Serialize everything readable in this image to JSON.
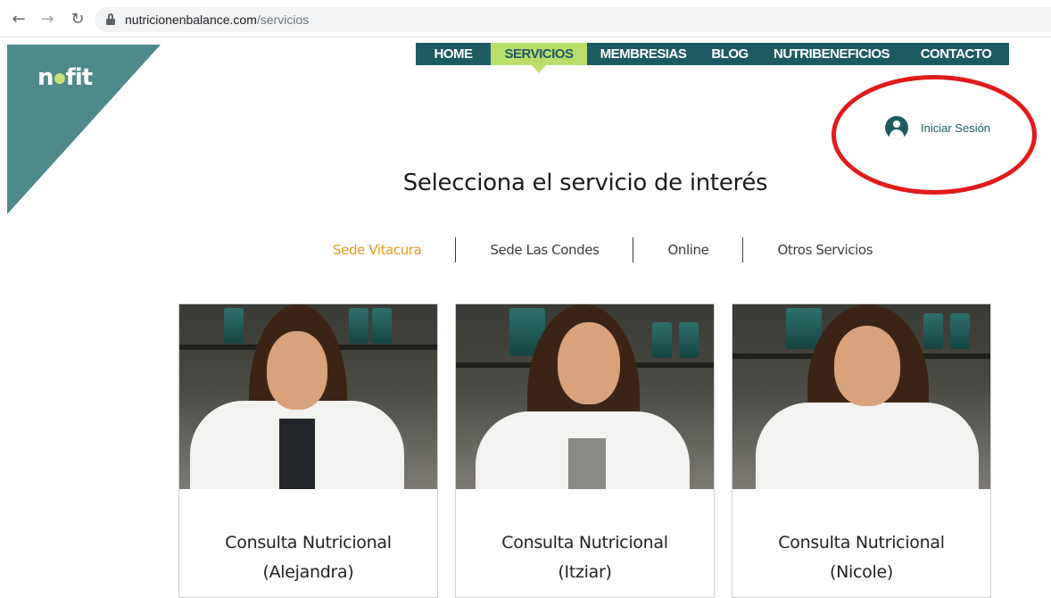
{
  "browser": {
    "url_domain": "nutricionenbalance.com",
    "url_path": "/servicios"
  },
  "logo": {
    "text_left": "n",
    "text_right": "fit"
  },
  "nav": {
    "items": [
      {
        "label": "HOME",
        "active": false
      },
      {
        "label": "SERVICIOS",
        "active": true
      },
      {
        "label": "MEMBRESIAS",
        "active": false
      },
      {
        "label": "BLOG",
        "active": false
      },
      {
        "label": "NUTRIBENEFICIOS",
        "active": false
      },
      {
        "label": "CONTACTO",
        "active": false
      }
    ]
  },
  "login": {
    "label": "Iniciar Sesión"
  },
  "title": "Selecciona el servicio de interés",
  "tabs": [
    {
      "label": "Sede Vitacura",
      "active": true
    },
    {
      "label": "Sede Las Condes",
      "active": false
    },
    {
      "label": "Online",
      "active": false
    },
    {
      "label": "Otros Servicios",
      "active": false
    }
  ],
  "cards": [
    {
      "line1": "Consulta Nutricional",
      "line2": "(Alejandra)"
    },
    {
      "line1": "Consulta Nutricional",
      "line2": "(Itziar)"
    },
    {
      "line1": "Consulta Nutricional",
      "line2": "(Nicole)"
    }
  ],
  "colors": {
    "nav_bg": "#1e5a64",
    "nav_active": "#b9de6b",
    "logo_bg": "#4f8a8b",
    "tab_active": "#e89a1c",
    "annotation_ring": "#e11b1b"
  }
}
